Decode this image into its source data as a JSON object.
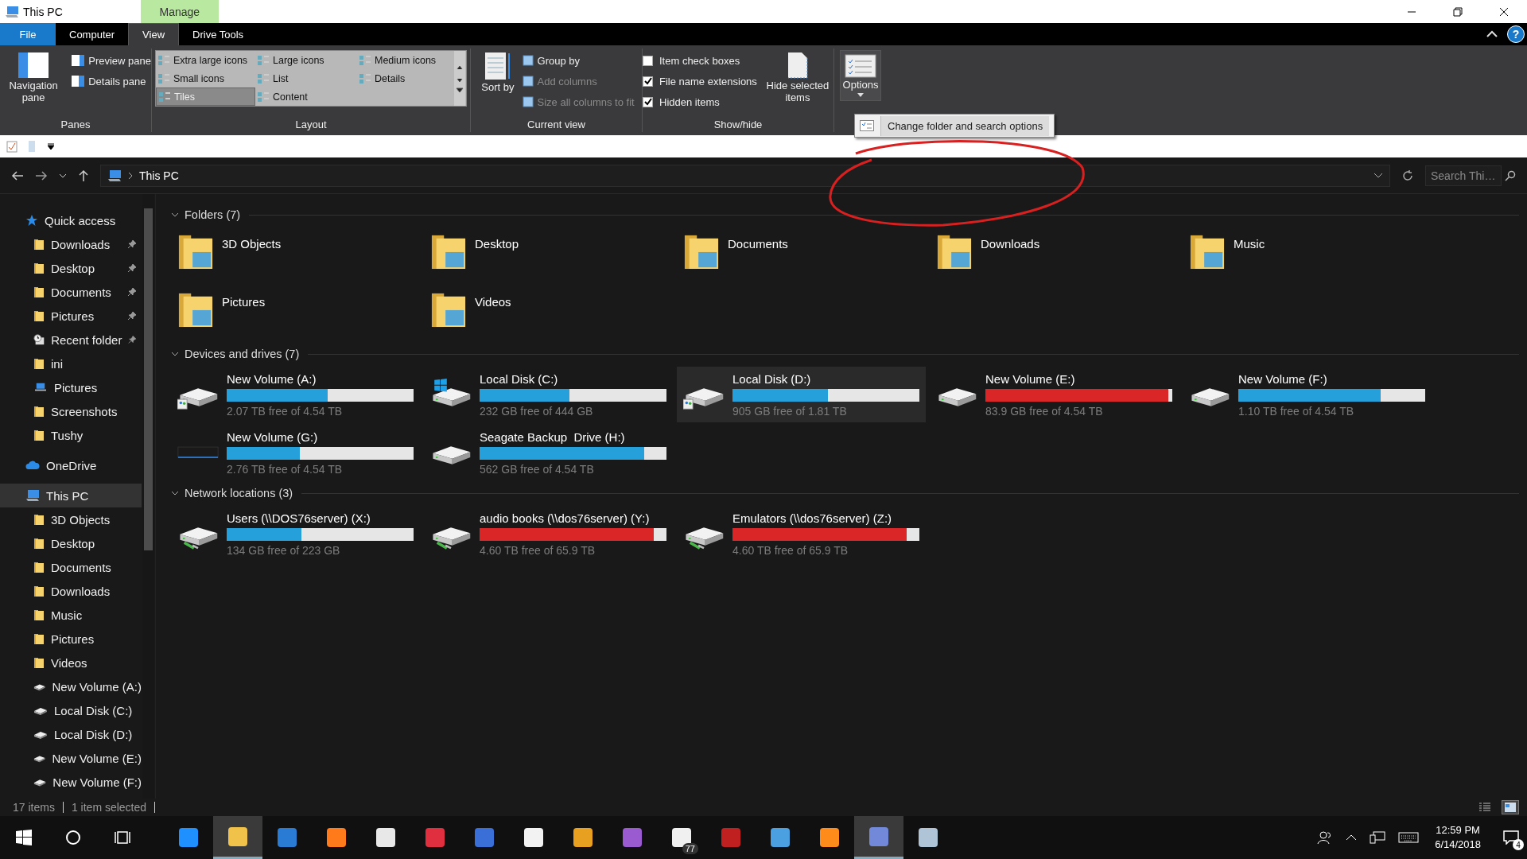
{
  "window": {
    "title": "This PC",
    "context_tab": "Manage"
  },
  "ribbon_tabs": [
    {
      "label": "File",
      "kind": "file",
      "selected": false
    },
    {
      "label": "Computer",
      "kind": "tab",
      "selected": false
    },
    {
      "label": "View",
      "kind": "tab",
      "selected": true
    },
    {
      "label": "Drive Tools",
      "kind": "tab",
      "selected": false
    }
  ],
  "help": "?",
  "ribbon": {
    "panes": {
      "label": "Panes",
      "navigation": "Navigation pane",
      "preview": "Preview pane",
      "details": "Details pane"
    },
    "layout": {
      "label": "Layout",
      "options": [
        {
          "label": "Extra large icons",
          "selected": false
        },
        {
          "label": "Large icons",
          "selected": false
        },
        {
          "label": "Medium icons",
          "selected": false
        },
        {
          "label": "Small icons",
          "selected": false
        },
        {
          "label": "List",
          "selected": false
        },
        {
          "label": "Details",
          "selected": false
        },
        {
          "label": "Tiles",
          "selected": true
        },
        {
          "label": "Content",
          "selected": false
        }
      ]
    },
    "current_view": {
      "label": "Current view",
      "sort": "Sort by",
      "commands": [
        {
          "label": "Group by",
          "disabled": false
        },
        {
          "label": "Add columns",
          "disabled": true
        },
        {
          "label": "Size all columns to fit",
          "disabled": true
        }
      ]
    },
    "show_hide": {
      "label": "Show/hide",
      "checkboxes": [
        {
          "label": "Item check boxes",
          "checked": false
        },
        {
          "label": "File name extensions",
          "checked": true
        },
        {
          "label": "Hidden items",
          "checked": true
        }
      ],
      "hide_selected": "Hide selected items"
    },
    "options": {
      "label": "Options",
      "menu_item": "Change folder and search options"
    }
  },
  "address": {
    "location": "This PC",
    "search_placeholder": "Search Thi…"
  },
  "sidebar": [
    {
      "label": "Quick access",
      "kind": "star",
      "selected": false,
      "children": [
        {
          "label": "Downloads",
          "kind": "folder",
          "pinned": true
        },
        {
          "label": "Desktop",
          "kind": "folder",
          "pinned": true
        },
        {
          "label": "Documents",
          "kind": "folder",
          "pinned": true
        },
        {
          "label": "Pictures",
          "kind": "folder",
          "pinned": true
        },
        {
          "label": "Recent folder",
          "kind": "clock",
          "pinned": true
        },
        {
          "label": "ini",
          "kind": "folder",
          "pinned": false
        },
        {
          "label": "Pictures",
          "kind": "computer",
          "pinned": false
        },
        {
          "label": "Screenshots",
          "kind": "folder",
          "pinned": false
        },
        {
          "label": "Tushy",
          "kind": "folder",
          "pinned": false
        }
      ]
    },
    {
      "label": "OneDrive",
      "kind": "cloud",
      "selected": false
    },
    {
      "label": "This PC",
      "kind": "computer",
      "selected": true,
      "children": [
        {
          "label": "3D Objects",
          "kind": "folder",
          "pinned": false
        },
        {
          "label": "Desktop",
          "kind": "folder",
          "pinned": false
        },
        {
          "label": "Documents",
          "kind": "folder",
          "pinned": false
        },
        {
          "label": "Downloads",
          "kind": "folder",
          "pinned": false
        },
        {
          "label": "Music",
          "kind": "folder",
          "pinned": false
        },
        {
          "label": "Pictures",
          "kind": "folder",
          "pinned": false
        },
        {
          "label": "Videos",
          "kind": "folder",
          "pinned": false
        },
        {
          "label": "New Volume (A:)",
          "kind": "drive",
          "pinned": false
        },
        {
          "label": "Local Disk (C:)",
          "kind": "drive",
          "pinned": false
        },
        {
          "label": "Local Disk (D:)",
          "kind": "drive",
          "pinned": false
        },
        {
          "label": "New Volume (E:)",
          "kind": "drive",
          "pinned": false
        },
        {
          "label": "New Volume (F:)",
          "kind": "drive",
          "pinned": false
        }
      ]
    }
  ],
  "groups": [
    {
      "title": "Folders (7)",
      "kind": "folders",
      "expanded": true,
      "items": [
        {
          "name": "3D Objects"
        },
        {
          "name": "Desktop"
        },
        {
          "name": "Documents"
        },
        {
          "name": "Downloads"
        },
        {
          "name": "Music"
        },
        {
          "name": "Pictures"
        },
        {
          "name": "Videos"
        }
      ]
    },
    {
      "title": "Devices and drives (7)",
      "kind": "drives",
      "expanded": true,
      "items": [
        {
          "name": "New Volume (A:)",
          "kind": "shared",
          "free": "2.07 TB free of 4.54 TB",
          "level": 0.54,
          "color": "#26a0da",
          "selected": false
        },
        {
          "name": "Local Disk (C:)",
          "kind": "system",
          "free": "232 GB free of 444 GB",
          "level": 0.48,
          "color": "#26a0da",
          "selected": false
        },
        {
          "name": "Local Disk (D:)",
          "kind": "shared",
          "free": "905 GB free of 1.81 TB",
          "level": 0.51,
          "color": "#26a0da",
          "selected": true
        },
        {
          "name": "New Volume (E:)",
          "kind": "plain",
          "free": "83.9 GB free of 4.54 TB",
          "level": 0.98,
          "color": "#da2626",
          "selected": false
        },
        {
          "name": "New Volume (F:)",
          "kind": "plain",
          "free": "1.10 TB free of 4.54 TB",
          "level": 0.76,
          "color": "#26a0da",
          "selected": false
        },
        {
          "name": "New Volume (G:)",
          "kind": "external",
          "free": "2.76 TB free of 4.54 TB",
          "level": 0.39,
          "color": "#26a0da",
          "selected": false
        },
        {
          "name": "Seagate Backup  Drive (H:)",
          "kind": "plain",
          "free": "562 GB free of 4.54 TB",
          "level": 0.88,
          "color": "#26a0da",
          "selected": false
        }
      ]
    },
    {
      "title": "Network locations (3)",
      "kind": "drives",
      "expanded": true,
      "items": [
        {
          "name": "Users (\\\\DOS76server) (X:)",
          "kind": "network",
          "free": "134 GB free of 223 GB",
          "level": 0.4,
          "color": "#26a0da",
          "selected": false
        },
        {
          "name": "audio books (\\\\dos76server) (Y:)",
          "kind": "network",
          "free": "4.60 TB free of 65.9 TB",
          "level": 0.93,
          "color": "#da2626",
          "selected": false
        },
        {
          "name": "Emulators (\\\\dos76server) (Z:)",
          "kind": "network",
          "free": "4.60 TB free of 65.9 TB",
          "level": 0.93,
          "color": "#da2626",
          "selected": false
        }
      ]
    }
  ],
  "status_bar": {
    "items": "17 items",
    "selection": "1 item selected",
    "views": [
      {
        "kind": "details",
        "selected": false
      },
      {
        "kind": "tiles",
        "selected": true
      }
    ]
  },
  "taskbar": {
    "apps": [
      {
        "color": "#1e90ff",
        "selected": false
      },
      {
        "color": "#f0c24a",
        "selected": true
      },
      {
        "color": "#2a7bd4",
        "selected": false
      },
      {
        "color": "#ff7a1a",
        "selected": false
      },
      {
        "color": "#e8e8e8",
        "selected": false
      },
      {
        "color": "#e03040",
        "selected": false
      },
      {
        "color": "#3a6fd8",
        "selected": false
      },
      {
        "color": "#f2f2f2",
        "selected": false
      },
      {
        "color": "#e8a020",
        "selected": false
      },
      {
        "color": "#9a5ad0",
        "selected": false
      },
      {
        "color": "#f0f0f0",
        "selected": false,
        "badge": "77"
      },
      {
        "color": "#c02020",
        "selected": false
      },
      {
        "color": "#4aa0e0",
        "selected": false
      },
      {
        "color": "#ff8c1a",
        "selected": false
      },
      {
        "color": "#7289da",
        "selected": true
      },
      {
        "color": "#b0c4d8",
        "selected": false
      }
    ],
    "time": "12:59 PM",
    "date": "6/14/2018",
    "notifications": "4"
  }
}
